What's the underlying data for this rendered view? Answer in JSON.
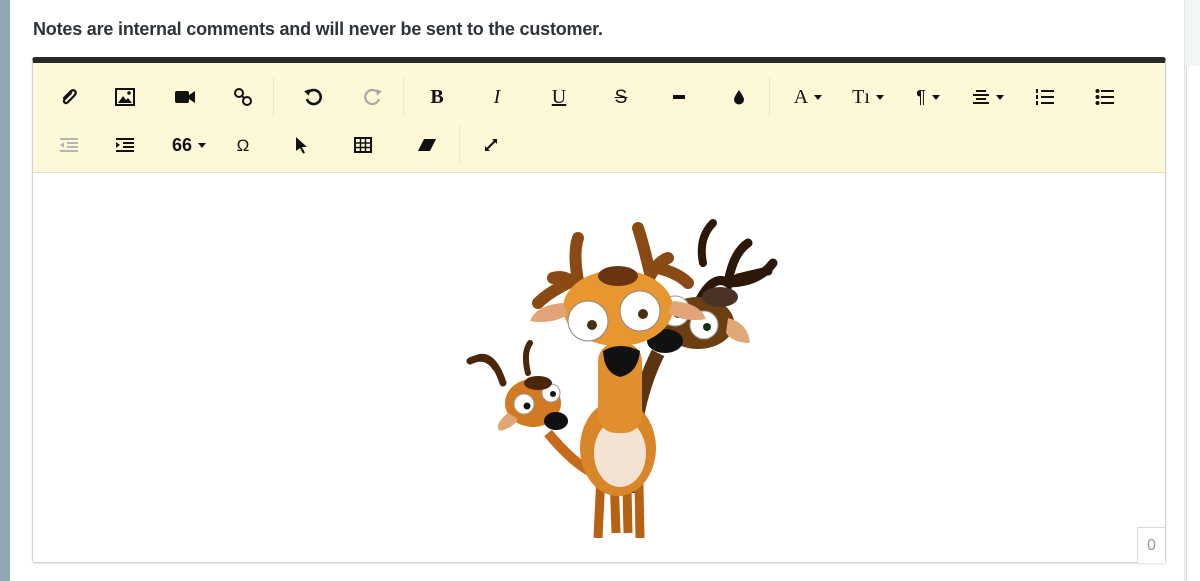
{
  "notice": "Notes are internal comments and will never be sent to the customer.",
  "toolbar": {
    "row1": [
      {
        "name": "attach",
        "icon": "paperclip-icon"
      },
      {
        "name": "image",
        "icon": "image-icon"
      },
      {
        "name": "video",
        "icon": "video-icon"
      },
      {
        "name": "link",
        "icon": "link-icon"
      },
      {
        "name": "undo",
        "icon": "undo-icon"
      },
      {
        "name": "redo",
        "icon": "redo-icon"
      },
      {
        "name": "bold",
        "label": "B"
      },
      {
        "name": "italic",
        "label": "I"
      },
      {
        "name": "underline",
        "label": "U"
      },
      {
        "name": "strikethrough",
        "label": "S"
      },
      {
        "name": "horizontal-rule",
        "icon": "minus-icon"
      },
      {
        "name": "color",
        "icon": "drop-icon"
      },
      {
        "name": "font-family",
        "label": "A"
      },
      {
        "name": "font-size",
        "label": "Tı"
      },
      {
        "name": "paragraph",
        "label": "¶"
      },
      {
        "name": "align",
        "icon": "align-icon"
      },
      {
        "name": "ordered-list",
        "icon": "ordered-list-icon"
      },
      {
        "name": "unordered-list",
        "icon": "unordered-list-icon"
      }
    ],
    "row2": [
      {
        "name": "outdent",
        "icon": "outdent-icon"
      },
      {
        "name": "indent",
        "icon": "indent-icon"
      },
      {
        "name": "quote",
        "label": "66"
      },
      {
        "name": "special-char",
        "label": "Ω"
      },
      {
        "name": "select",
        "icon": "cursor-icon"
      },
      {
        "name": "table",
        "icon": "table-icon"
      },
      {
        "name": "clear-format",
        "icon": "eraser-icon"
      },
      {
        "name": "fullscreen",
        "icon": "expand-icon"
      }
    ]
  },
  "content": {
    "image": "reindeer-cartoon-image"
  },
  "char_count": "0",
  "colors": {
    "toolbar_bg": "#fdf8d8",
    "left_bar": "#8fa7b1",
    "editor_top_border": "#2a2a2a"
  }
}
